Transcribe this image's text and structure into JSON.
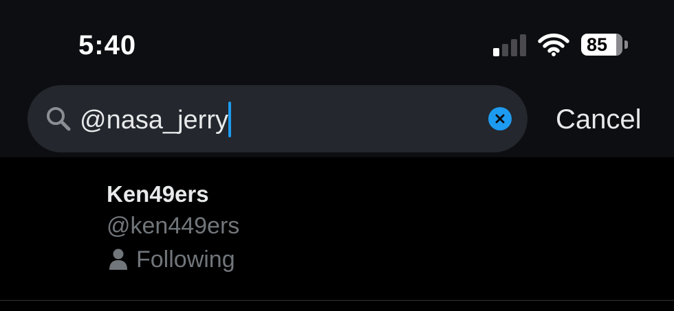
{
  "status_bar": {
    "time": "5:40",
    "battery_level": "85",
    "signal_bars_active": 1,
    "signal_bars_total": 4
  },
  "search": {
    "value": "@nasa_jerry",
    "cancel_label": "Cancel"
  },
  "results": [
    {
      "name": "Ken49ers",
      "handle": "@ken449ers",
      "relationship": "Following"
    }
  ],
  "colors": {
    "accent": "#1d9bf0",
    "background": "#000000",
    "header_background": "#0d0e11",
    "search_background": "#24272d",
    "secondary_text": "#71767b"
  },
  "icons": {
    "search": "search-icon",
    "clear": "clear-icon",
    "person": "person-icon",
    "wifi": "wifi-icon",
    "signal": "signal-icon",
    "battery": "battery-icon"
  }
}
